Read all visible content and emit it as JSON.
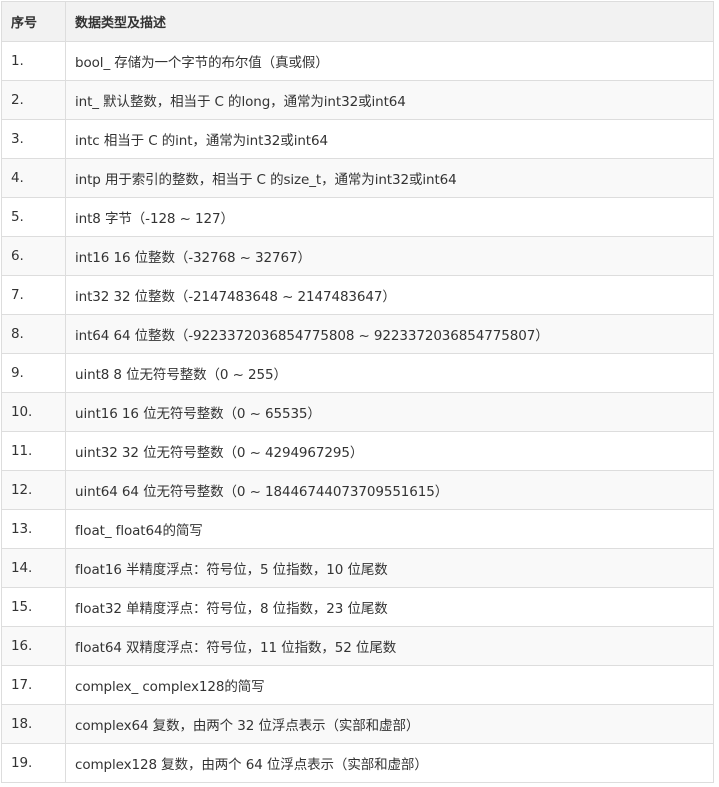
{
  "table": {
    "headers": {
      "index": "序号",
      "description": "数据类型及描述"
    },
    "rows": [
      {
        "index": "1.",
        "description": "bool_ 存储为一个字节的布尔值（真或假）"
      },
      {
        "index": "2.",
        "description": "int_ 默认整数，相当于 C 的long，通常为int32或int64"
      },
      {
        "index": "3.",
        "description": "intc 相当于 C 的int，通常为int32或int64"
      },
      {
        "index": "4.",
        "description": "intp 用于索引的整数，相当于 C 的size_t，通常为int32或int64"
      },
      {
        "index": "5.",
        "description": "int8 字节（-128 ~ 127）"
      },
      {
        "index": "6.",
        "description": "int16 16 位整数（-32768 ~ 32767）"
      },
      {
        "index": "7.",
        "description": "int32 32 位整数（-2147483648 ~ 2147483647）"
      },
      {
        "index": "8.",
        "description": "int64 64 位整数（-9223372036854775808 ~ 9223372036854775807）"
      },
      {
        "index": "9.",
        "description": "uint8 8 位无符号整数（0 ~ 255）"
      },
      {
        "index": "10.",
        "description": "uint16 16 位无符号整数（0 ~ 65535）"
      },
      {
        "index": "11.",
        "description": "uint32 32 位无符号整数（0 ~ 4294967295）"
      },
      {
        "index": "12.",
        "description": "uint64 64 位无符号整数（0 ~ 18446744073709551615）"
      },
      {
        "index": "13.",
        "description": "float_ float64的简写"
      },
      {
        "index": "14.",
        "description": "float16 半精度浮点：符号位，5 位指数，10 位尾数"
      },
      {
        "index": "15.",
        "description": "float32 单精度浮点：符号位，8 位指数，23 位尾数"
      },
      {
        "index": "16.",
        "description": "float64 双精度浮点：符号位，11 位指数，52 位尾数"
      },
      {
        "index": "17.",
        "description": "complex_ complex128的简写"
      },
      {
        "index": "18.",
        "description": "complex64 复数，由两个 32 位浮点表示（实部和虚部）"
      },
      {
        "index": "19.",
        "description": "complex128 复数，由两个 64 位浮点表示（实部和虚部）"
      }
    ]
  }
}
